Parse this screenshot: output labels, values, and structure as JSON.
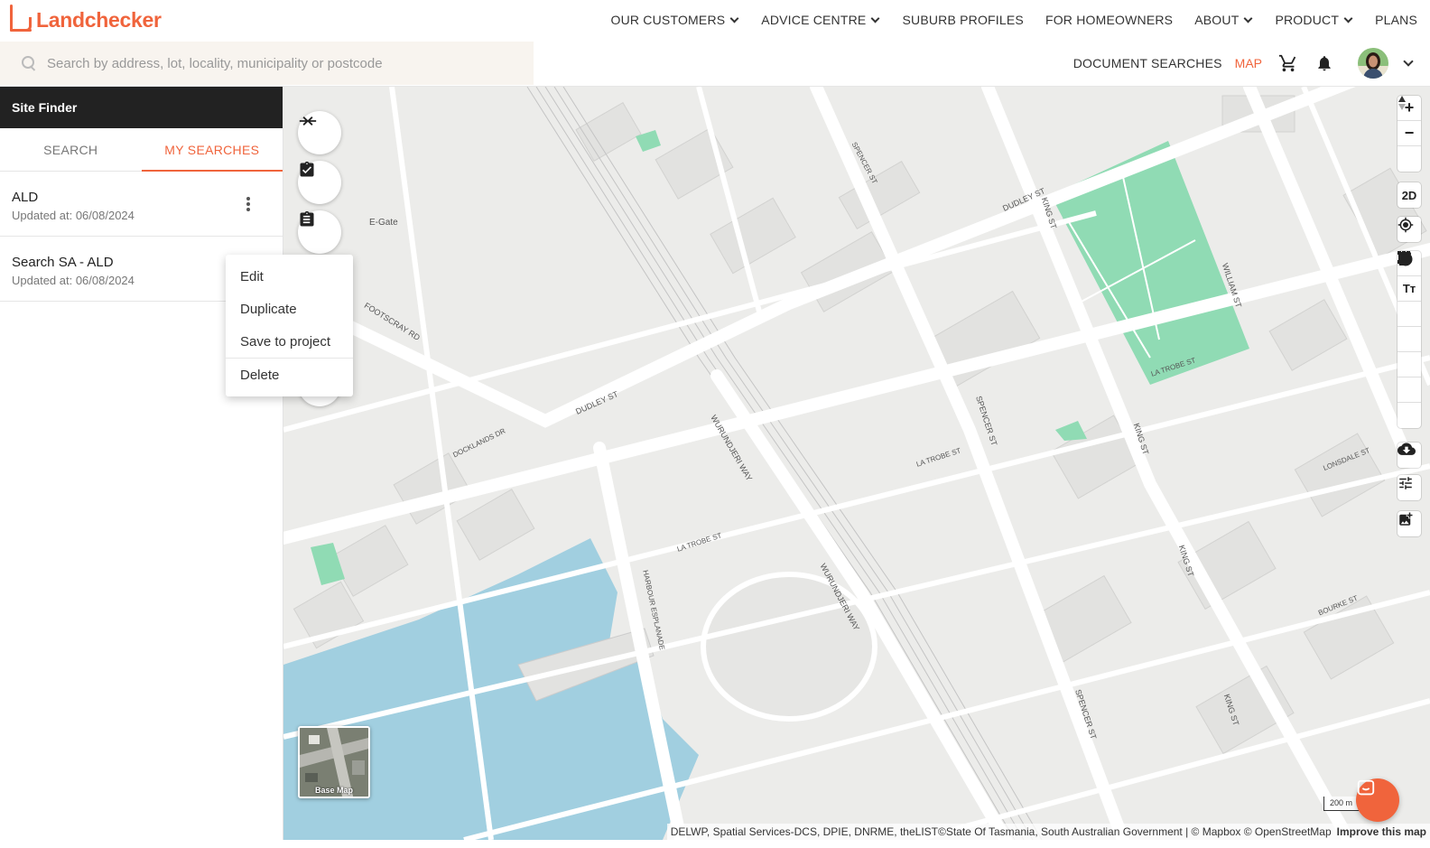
{
  "brand": {
    "name": "Landchecker"
  },
  "nav": {
    "items": [
      {
        "label": "OUR CUSTOMERS",
        "dropdown": true
      },
      {
        "label": "ADVICE CENTRE",
        "dropdown": true
      },
      {
        "label": "SUBURB PROFILES",
        "dropdown": false
      },
      {
        "label": "FOR HOMEOWNERS",
        "dropdown": false
      },
      {
        "label": "ABOUT",
        "dropdown": true
      },
      {
        "label": "PRODUCT",
        "dropdown": true
      },
      {
        "label": "PLANS",
        "dropdown": false
      }
    ]
  },
  "search": {
    "placeholder": "Search by address, lot, locality, municipality or postcode",
    "value": ""
  },
  "actions": {
    "document_searches": "DOCUMENT SEARCHES",
    "map": "MAP"
  },
  "sidebar": {
    "title": "Site Finder",
    "tabs": [
      {
        "label": "SEARCH",
        "active": false
      },
      {
        "label": "MY SEARCHES",
        "active": true
      }
    ],
    "saved": [
      {
        "name": "ALD",
        "updated": "Updated at: 06/08/2024"
      },
      {
        "name": "Search SA - ALD",
        "updated": "Updated at: 06/08/2024"
      }
    ]
  },
  "context_menu": {
    "items": [
      "Edit",
      "Duplicate",
      "Save to project",
      "Delete"
    ]
  },
  "map": {
    "labels": {
      "egate": "E-Gate",
      "footscray": "FOOTSCRAY RD",
      "dudley1": "DUDLEY ST",
      "dudley2": "DUDLEY ST",
      "wurundjeri1": "WURUNDJERI WAY",
      "wurundjeri2": "WURUNDJERI WAY",
      "spencer1": "SPENCER ST",
      "spencer2": "SPENCER ST",
      "spencer3": "SPENCER ST",
      "king1": "KING ST",
      "king2": "KING ST",
      "king3": "KING ST",
      "king4": "KING ST",
      "william1": "WILLIAM ST",
      "latrobe1": "LA TROBE ST",
      "latrobe2": "LA TROBE ST",
      "latrobe3": "LA TROBE ST",
      "harbour": "HARBOUR ESPLANADE",
      "docklands": "DOCKLANDS DR",
      "lonsdale": "LONSDALE ST",
      "bourke": "BOURKE ST"
    },
    "toolbar": {
      "mode_2d": "2D",
      "text_tool": "Tт"
    },
    "basemap_label": "Base Map",
    "scale_label": "200 m",
    "attribution": "DELWP, Spatial Services-DCS, DPIE, DNRME, theLIST©State Of Tasmania, South Australian Government | © Mapbox © OpenStreetMap",
    "improve": "Improve this map"
  },
  "colors": {
    "accent": "#f0643c",
    "park": "#90dbb4",
    "water": "#a1cfe0",
    "map_bg": "#ececea",
    "road": "#ffffff"
  }
}
